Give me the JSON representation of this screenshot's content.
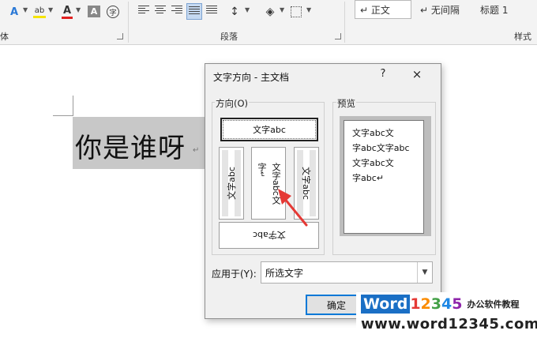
{
  "ribbon": {
    "groups": {
      "font": "体",
      "paragraph": "段落",
      "styles": "样式"
    },
    "styles": [
      {
        "label": "↵ 正文"
      },
      {
        "label": "↵ 无间隔"
      },
      {
        "label": "标题 1"
      }
    ],
    "font_color_hex": "#e02020",
    "highlight_hex": "#f5e400",
    "accent_hex": "#2b79d6"
  },
  "document": {
    "text": "你是谁呀",
    "paragraph_mark": "↵"
  },
  "dialog": {
    "title": "文字方向 - 主文档",
    "help": "?",
    "close": "×",
    "direction_label": "方向(O)",
    "preview_label": "预览",
    "options": [
      {
        "id": "horizontal",
        "text": "文字abc"
      },
      {
        "id": "vert-left",
        "text": "文字abc"
      },
      {
        "id": "vert-stack",
        "text": "文字abc文"
      },
      {
        "id": "vert-right",
        "text": "文字abc"
      },
      {
        "id": "horizontal-flipped",
        "text": "文字abc"
      }
    ],
    "vert_stack_prefix": "字",
    "vert_stack_arrow": "↵",
    "preview_lines": [
      "文字abc文",
      "字abc文字abc",
      "文字abc文",
      "字abc↵"
    ],
    "apply_label": "应用于(Y):",
    "apply_value": "所选文字",
    "ok_button": "确定"
  },
  "watermark": {
    "word": "Word",
    "digits": [
      "1",
      "2",
      "3",
      "4",
      "5"
    ],
    "digit_colors": [
      "#e53935",
      "#fb8c00",
      "#43a047",
      "#1e88e5",
      "#8e24aa"
    ],
    "subtitle": "办公软件教程",
    "url": "www.word12345.com"
  }
}
